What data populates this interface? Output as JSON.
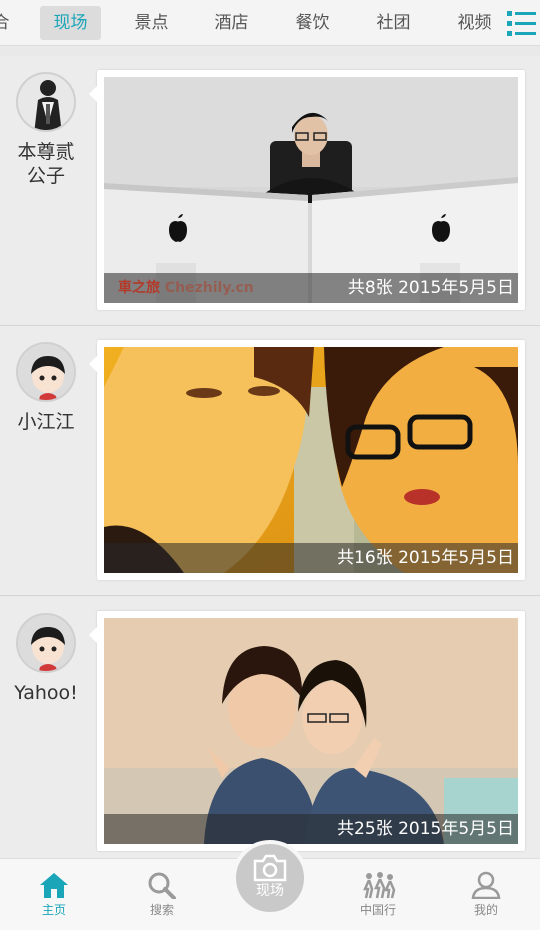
{
  "top_tabs": [
    "合",
    "现场",
    "景点",
    "酒店",
    "餐饮",
    "社团",
    "视频"
  ],
  "active_tab_index": 1,
  "feed": [
    {
      "username": "本尊贰公子",
      "caption": "共8张 2015年5月5日",
      "watermark": "車之旅",
      "watermark_en": "Chezhily.cn"
    },
    {
      "username": "小江江",
      "caption": "共16张 2015年5月5日"
    },
    {
      "username": "Yahoo!",
      "caption": "共25张 2015年5月5日"
    }
  ],
  "bottom_nav": {
    "home": "主页",
    "search": "搜索",
    "camera": "现场",
    "china_travel": "中国行",
    "mine": "我的"
  },
  "colors": {
    "accent": "#1aa5b8"
  }
}
